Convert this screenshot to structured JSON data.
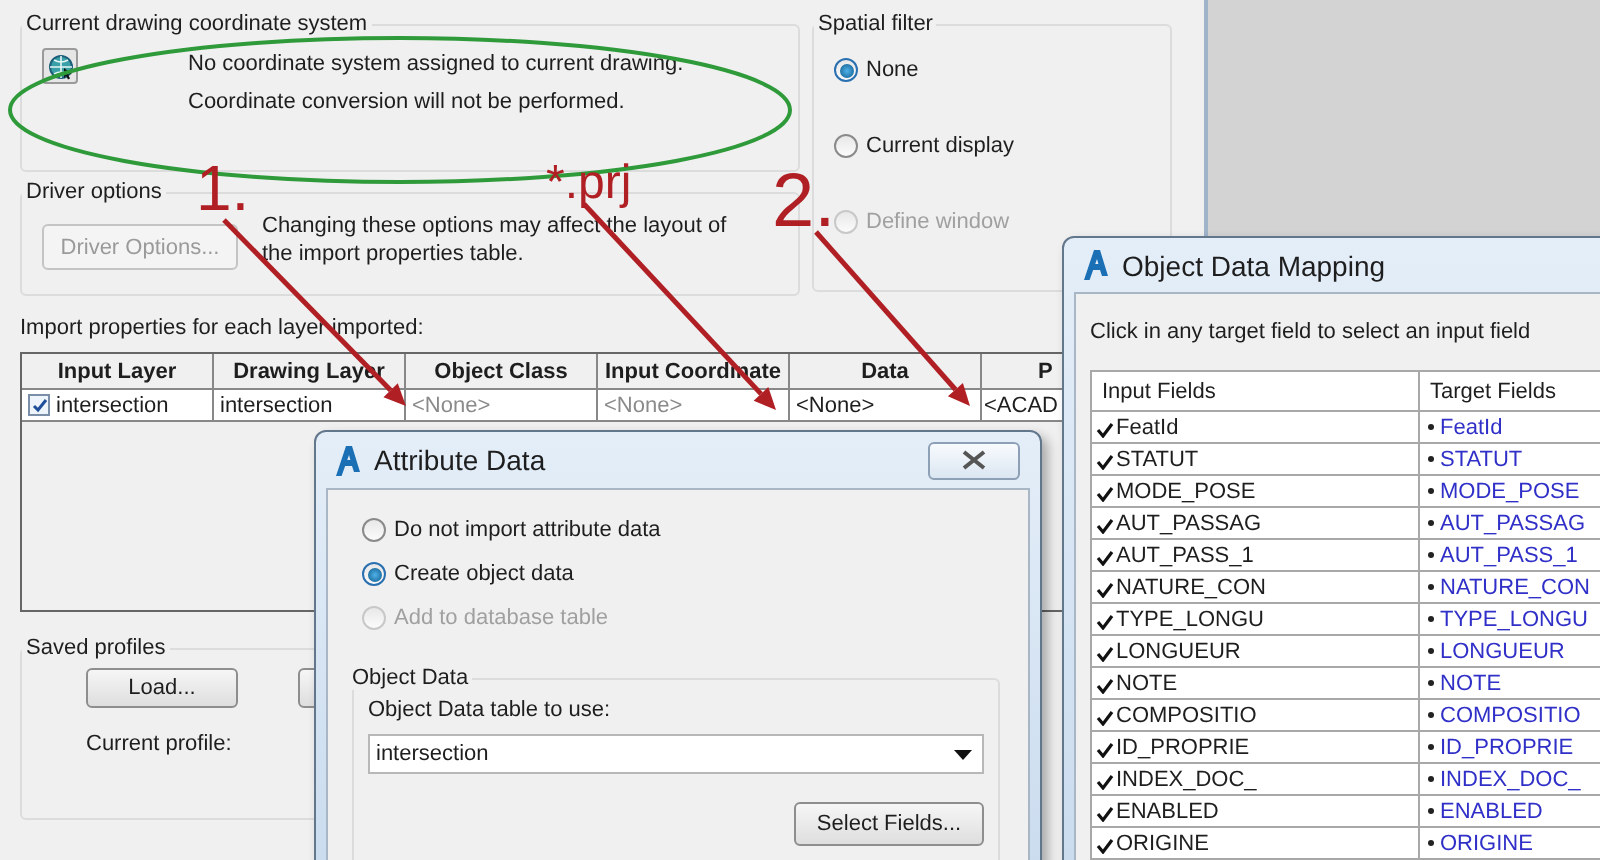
{
  "main_dialog": {
    "coordinate_system": {
      "title": "Current drawing coordinate system",
      "messages": [
        "No coordinate system assigned to current drawing.",
        "Coordinate conversion will not be performed."
      ]
    },
    "spatial_filter": {
      "title": "Spatial filter",
      "options": [
        {
          "label": "None",
          "selected": true,
          "disabled": false
        },
        {
          "label": "Current display",
          "selected": false,
          "disabled": false
        },
        {
          "label": "Define window",
          "selected": false,
          "disabled": true
        }
      ]
    },
    "driver_options": {
      "title": "Driver options",
      "button": {
        "label": "Driver Options...",
        "disabled": true
      },
      "note": "Changing these options may affect the layout of the import properties table."
    },
    "import_table": {
      "caption": "Import properties for each layer imported:",
      "columns": [
        "Input Layer",
        "Drawing Layer",
        "Object Class",
        "Input Coordinate",
        "Data",
        "P"
      ],
      "rows": [
        {
          "checked": true,
          "cells": [
            {
              "text": "intersection",
              "dimmed": false
            },
            {
              "text": "intersection",
              "dimmed": false
            },
            {
              "text": "<None>",
              "dimmed": true
            },
            {
              "text": "<None>",
              "dimmed": true
            },
            {
              "text": "<None>",
              "dimmed": false
            },
            {
              "text": "<ACAD",
              "dimmed": false
            }
          ]
        }
      ]
    },
    "saved_profiles": {
      "title": "Saved profiles",
      "buttons": [
        "Load..."
      ],
      "current_profile_label": "Current profile:"
    }
  },
  "annotations": {
    "labels": [
      "1.",
      "*.prj",
      "2."
    ]
  },
  "attribute_data": {
    "title": "Attribute Data",
    "options": [
      {
        "label": "Do not import attribute data",
        "selected": false,
        "disabled": false
      },
      {
        "label": "Create object data",
        "selected": true,
        "disabled": false
      },
      {
        "label": "Add to database table",
        "selected": false,
        "disabled": true
      }
    ],
    "object_data": {
      "title": "Object Data",
      "table_label": "Object Data table to use:",
      "table_value": "intersection",
      "select_button": "Select Fields..."
    }
  },
  "object_data_mapping": {
    "title": "Object Data Mapping",
    "instruction": "Click in any target field to select an input field",
    "columns": [
      "Input Fields",
      "Target Fields"
    ],
    "rows": [
      {
        "input": "FeatId",
        "checked": true,
        "target": "FeatId"
      },
      {
        "input": "STATUT",
        "checked": true,
        "target": "STATUT"
      },
      {
        "input": "MODE_POSE",
        "checked": true,
        "target": "MODE_POSE"
      },
      {
        "input": "AUT_PASSAG",
        "checked": true,
        "target": "AUT_PASSAG"
      },
      {
        "input": "AUT_PASS_1",
        "checked": true,
        "target": "AUT_PASS_1"
      },
      {
        "input": "NATURE_CON",
        "checked": true,
        "target": "NATURE_CON"
      },
      {
        "input": "TYPE_LONGU",
        "checked": true,
        "target": "TYPE_LONGU"
      },
      {
        "input": "LONGUEUR",
        "checked": true,
        "target": "LONGUEUR"
      },
      {
        "input": "NOTE",
        "checked": true,
        "target": "NOTE"
      },
      {
        "input": "COMPOSITIO",
        "checked": true,
        "target": "COMPOSITIO"
      },
      {
        "input": "ID_PROPRIE",
        "checked": true,
        "target": "ID_PROPRIE"
      },
      {
        "input": "INDEX_DOC_",
        "checked": true,
        "target": "INDEX_DOC_"
      },
      {
        "input": "ENABLED",
        "checked": true,
        "target": "ENABLED"
      },
      {
        "input": "ORIGINE",
        "checked": true,
        "target": "ORIGINE"
      }
    ]
  }
}
